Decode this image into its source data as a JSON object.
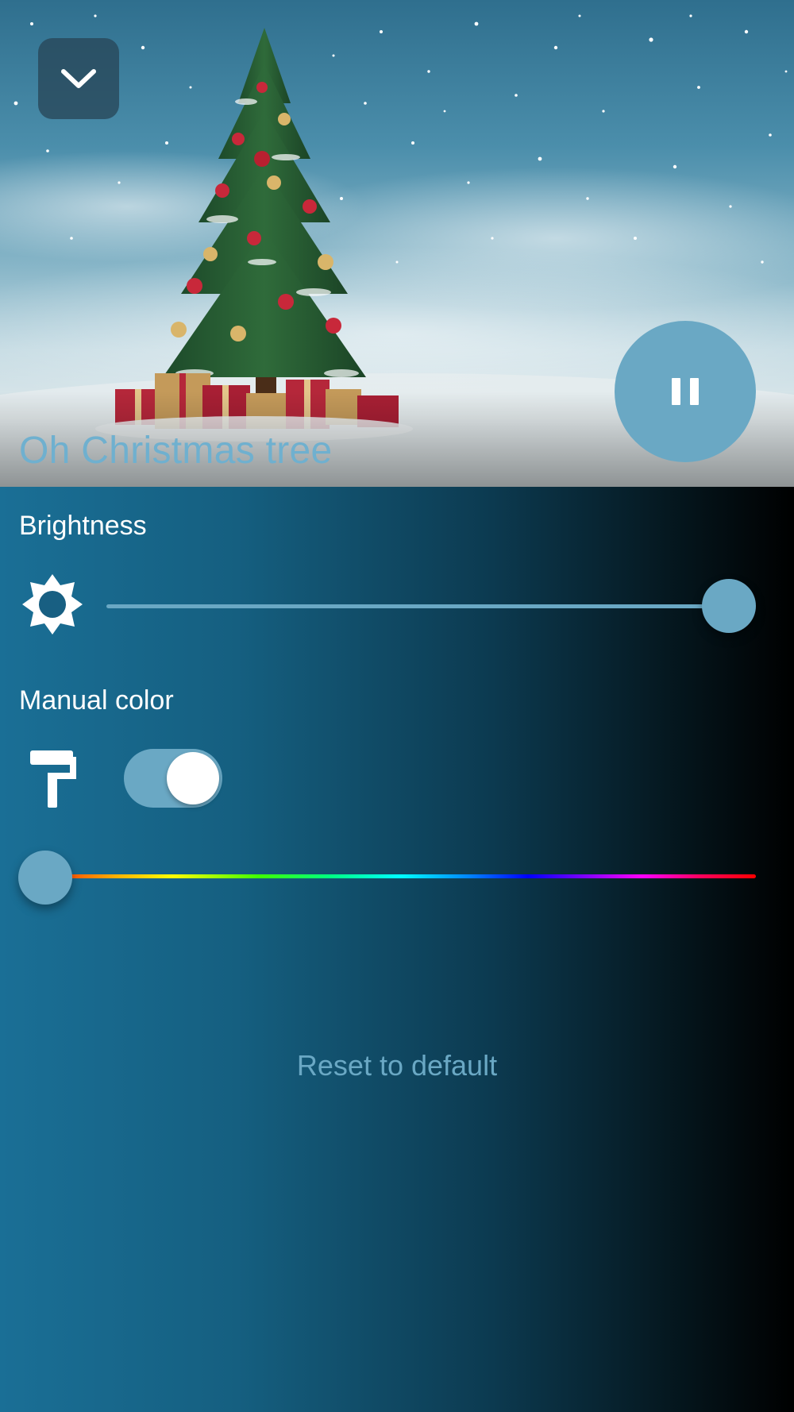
{
  "header": {
    "collapse_icon": "chevron-down-icon",
    "track_title": "Oh Christmas tree",
    "playback_icon": "pause-icon",
    "playback_state": "playing"
  },
  "brightness": {
    "label": "Brightness",
    "icon": "sun-icon",
    "value_fraction": 1.0
  },
  "manual_color": {
    "label": "Manual color",
    "icon": "paint-roller-icon",
    "enabled": true,
    "hue_fraction": 0.0
  },
  "reset": {
    "label": "Reset to default"
  },
  "colors": {
    "accent": "#6aa8c4",
    "title_text": "#6fb0cf",
    "panel_gradient_start": "#1a6f96",
    "panel_gradient_end": "#000000"
  }
}
